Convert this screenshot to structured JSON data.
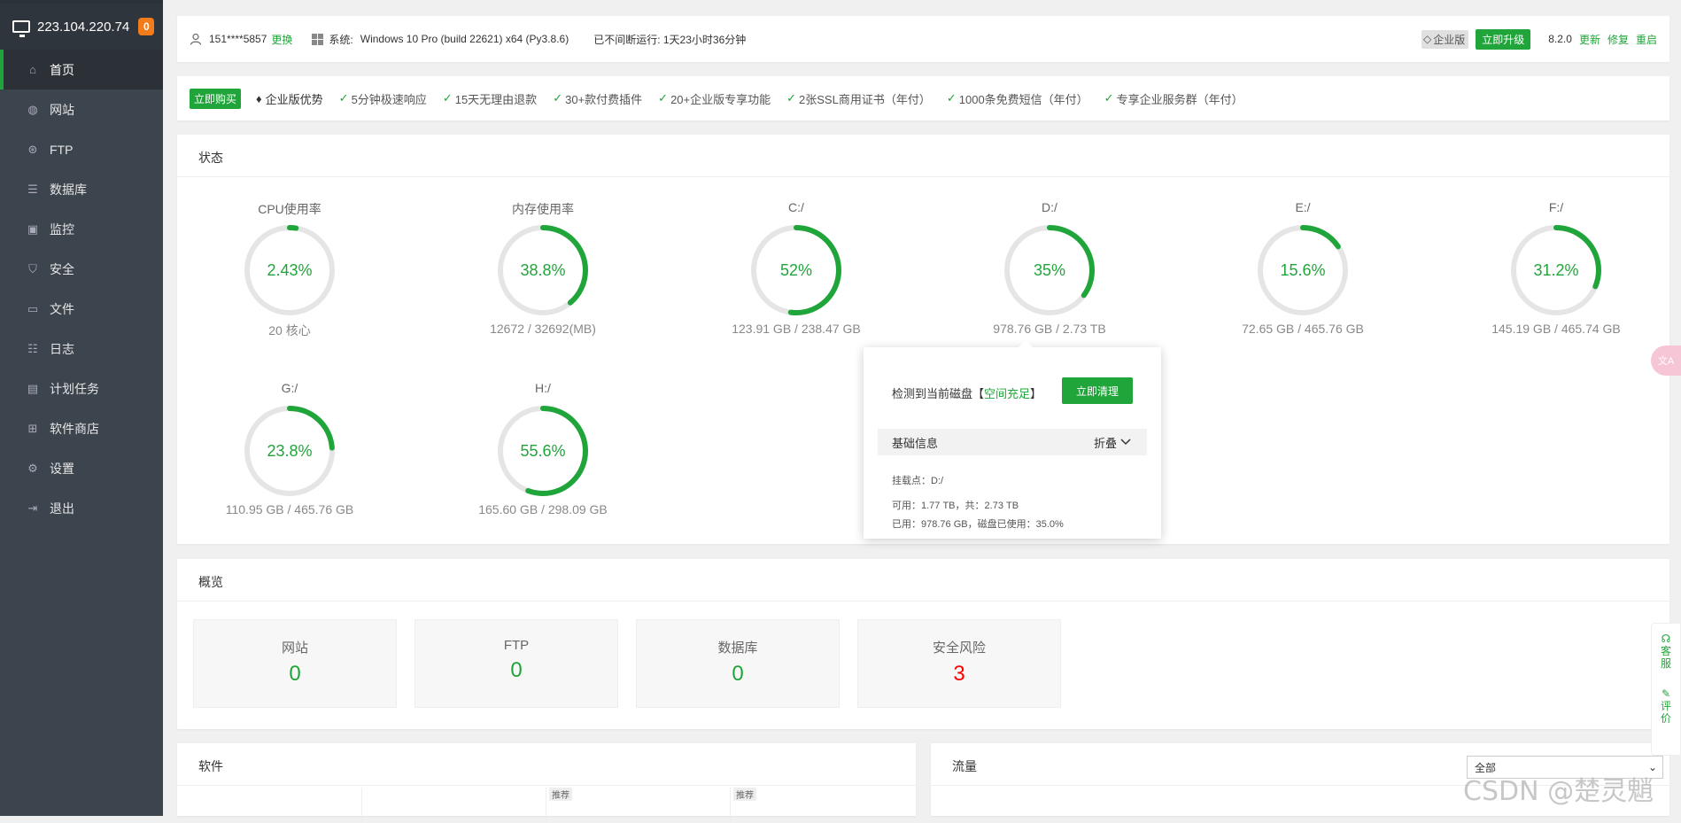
{
  "sidebar": {
    "server_ip": "223.104.220.74",
    "badge": "0",
    "items": [
      {
        "label": "首页",
        "icon": "home-icon"
      },
      {
        "label": "网站",
        "icon": "globe-icon"
      },
      {
        "label": "FTP",
        "icon": "ftp-icon"
      },
      {
        "label": "数据库",
        "icon": "database-icon"
      },
      {
        "label": "监控",
        "icon": "monitor-icon"
      },
      {
        "label": "安全",
        "icon": "shield-icon"
      },
      {
        "label": "文件",
        "icon": "folder-icon"
      },
      {
        "label": "日志",
        "icon": "log-icon"
      },
      {
        "label": "计划任务",
        "icon": "calendar-icon"
      },
      {
        "label": "软件商店",
        "icon": "grid-icon"
      },
      {
        "label": "设置",
        "icon": "gear-icon"
      },
      {
        "label": "退出",
        "icon": "logout-icon"
      }
    ]
  },
  "header": {
    "phone": "151****5857",
    "switch": "更换",
    "sys_label": "系统:",
    "sys_value": "Windows 10 Pro (build 22621) x64 (Py3.8.6)",
    "uptime": "已不间断运行: 1天23小时36分钟",
    "enterprise": "企业版",
    "upgrade": "立即升级",
    "version": "8.2.0",
    "update": "更新",
    "repair": "修复",
    "restart": "重启"
  },
  "adbar": {
    "buy": "立即购买",
    "title": "企业版优势",
    "features": [
      "5分钟极速响应",
      "15天无理由退款",
      "30+款付费插件",
      "20+企业版专享功能",
      "2张SSL商用证书（年付）",
      "1000条免费短信（年付）",
      "专享企业服务群（年付）"
    ]
  },
  "status": {
    "title": "状态",
    "gauges": [
      {
        "name": "CPU使用率",
        "value": "2.43%",
        "percent": 2.43,
        "sub": "20 核心"
      },
      {
        "name": "内存使用率",
        "value": "38.8%",
        "percent": 38.8,
        "sub": "12672 / 32692(MB)"
      },
      {
        "name": "C:/",
        "value": "52%",
        "percent": 52,
        "sub": "123.91 GB / 238.47 GB"
      },
      {
        "name": "D:/",
        "value": "35%",
        "percent": 35,
        "sub": "978.76 GB / 2.73 TB"
      },
      {
        "name": "E:/",
        "value": "15.6%",
        "percent": 15.6,
        "sub": "72.65 GB / 465.76 GB"
      },
      {
        "name": "F:/",
        "value": "31.2%",
        "percent": 31.2,
        "sub": "145.19 GB / 465.74 GB"
      },
      {
        "name": "G:/",
        "value": "23.8%",
        "percent": 23.8,
        "sub": "110.95 GB / 465.76 GB"
      },
      {
        "name": "H:/",
        "value": "55.6%",
        "percent": 55.6,
        "sub": "165.60 GB / 298.09 GB"
      }
    ],
    "accent": "#20a53a",
    "track": "#e5e5e5"
  },
  "popup": {
    "detect": "检测到当前磁盘【",
    "status": "空间充足",
    "detect_end": "】",
    "clean": "立即清理",
    "basic": "基础信息",
    "fold": "折叠",
    "mount": "挂载点：D:/",
    "avail": "可用：1.77 TB，共：2.73 TB",
    "used": "已用：978.76 GB，磁盘已使用：35.0%"
  },
  "overview": {
    "title": "概览",
    "cards": [
      {
        "label": "网站",
        "value": "0"
      },
      {
        "label": "FTP",
        "value": "0"
      },
      {
        "label": "数据库",
        "value": "0"
      },
      {
        "label": "安全风险",
        "value": "3"
      }
    ]
  },
  "software": {
    "title": "软件",
    "tag": "推荐"
  },
  "traffic": {
    "title": "流量",
    "select": "全部"
  },
  "float": {
    "service": "客服",
    "review": "评价"
  },
  "watermark": "CSDN @楚灵魈"
}
